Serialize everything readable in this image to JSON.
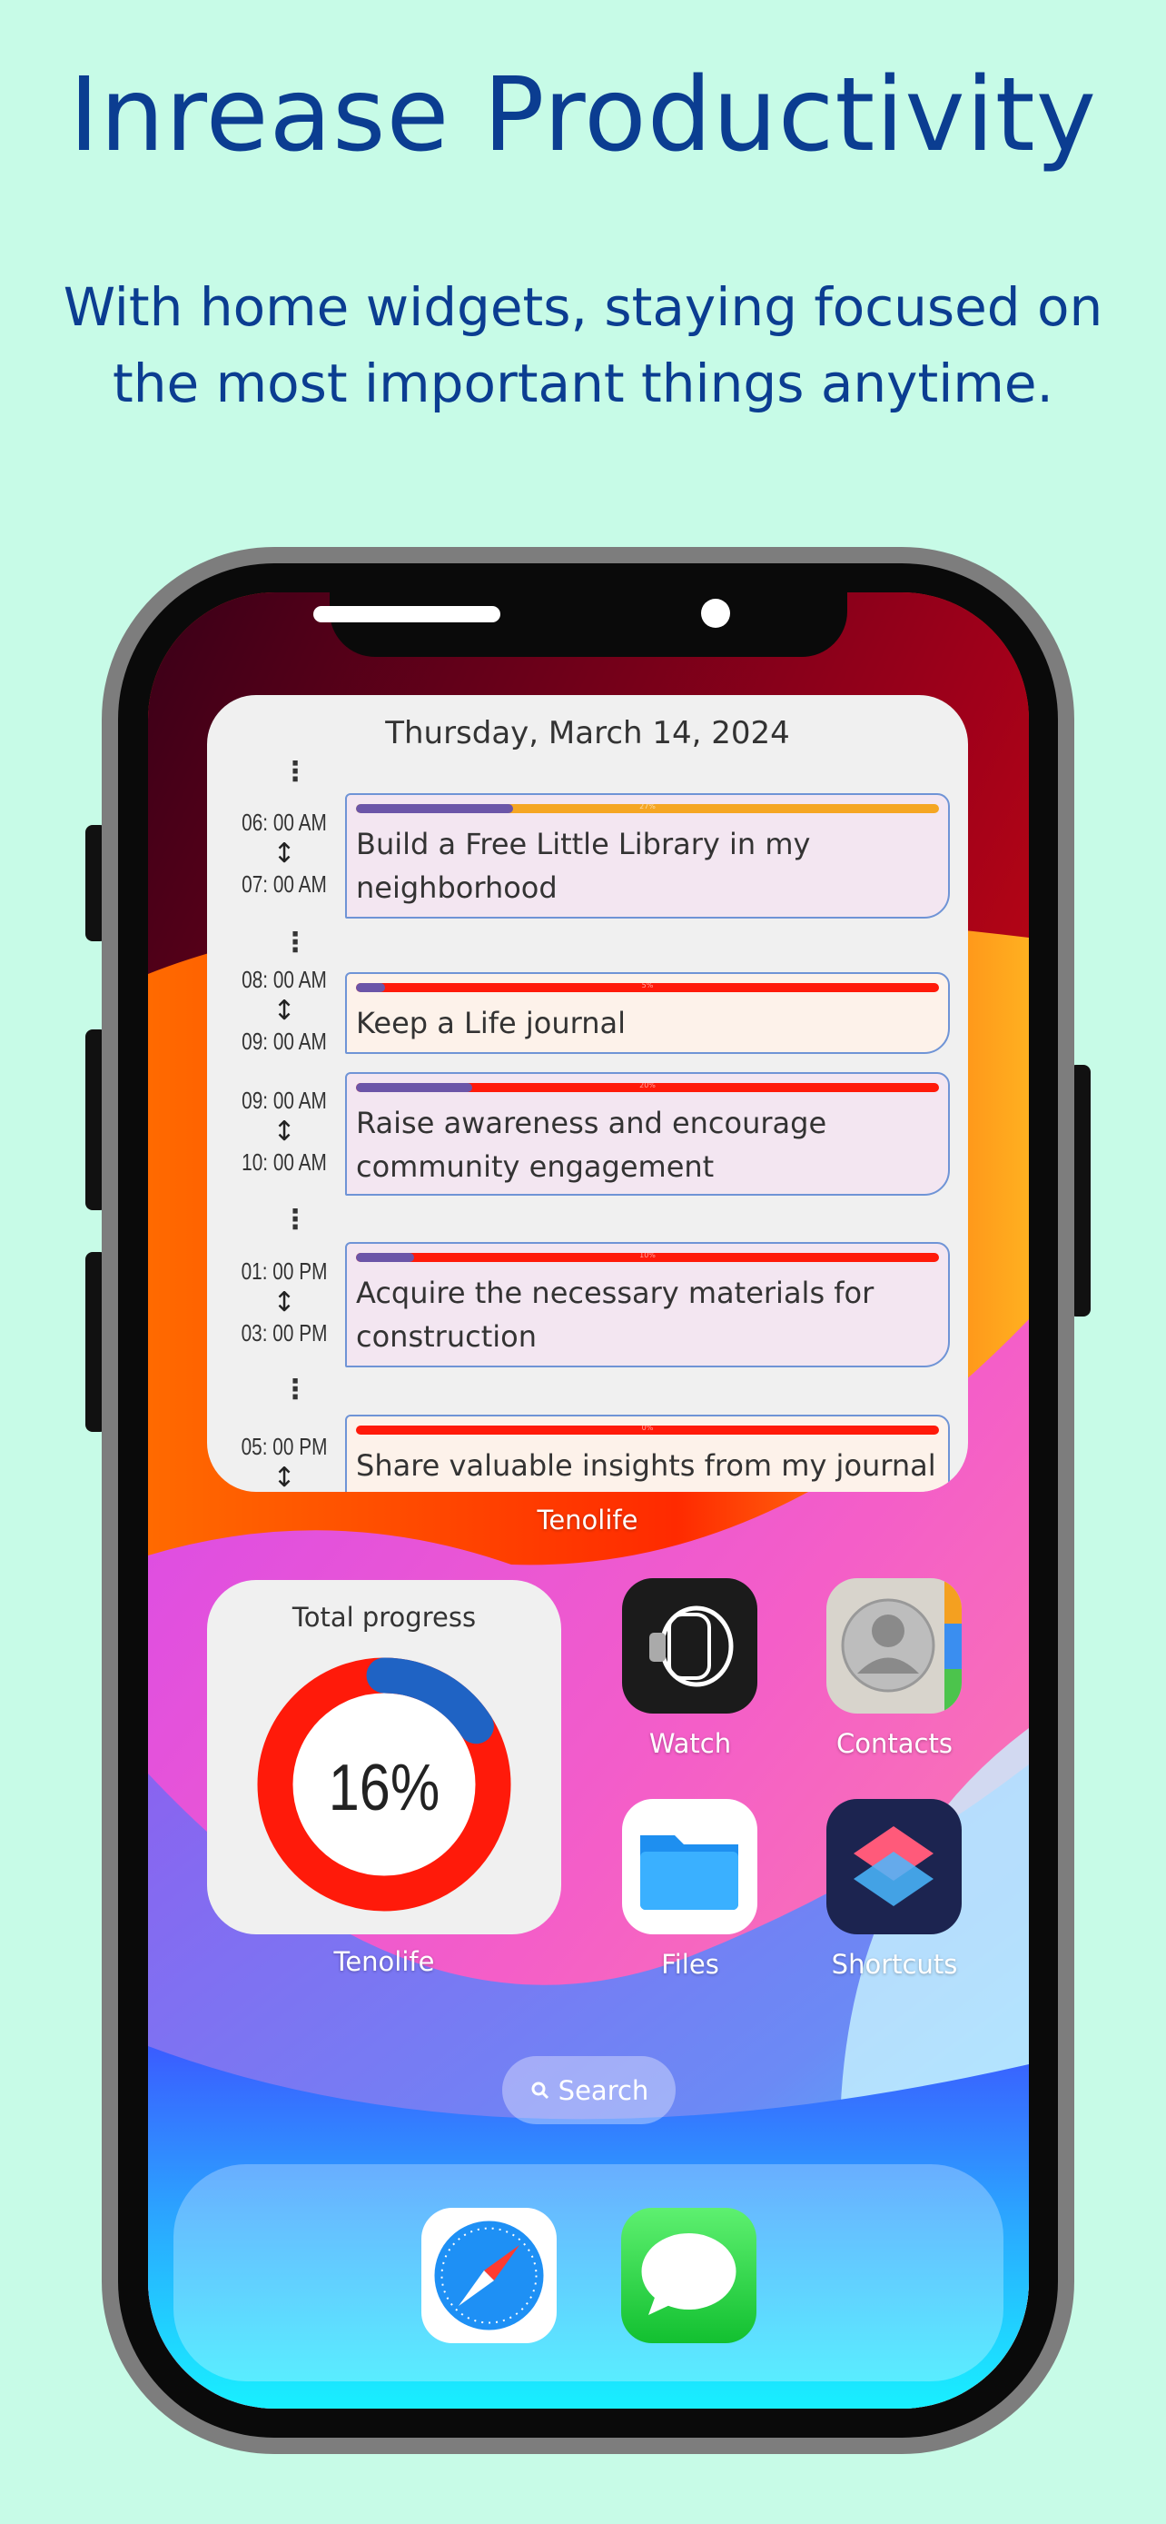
{
  "header": {
    "title": "Inrease Productivity",
    "subtitle_line1": "With home widgets, staying focused on",
    "subtitle_line2": "the most important things anytime."
  },
  "schedule_widget": {
    "date": "Thursday, March 14, 2024",
    "app_label": "Tenolife",
    "items": [
      {
        "start": "06: 00 AM",
        "end": "07: 00 AM",
        "title": "Build a Free Little Library in my neighborhood",
        "progress": 27,
        "progress_label": "27%",
        "track_color": "#f5a623",
        "card_color": "#f3e6f1"
      },
      {
        "start": "08: 00 AM",
        "end": "09: 00 AM",
        "title": "Keep a Life journal",
        "progress": 5,
        "progress_label": "5%",
        "track_color": "#ff1a0a",
        "card_color": "#fdf2ea"
      },
      {
        "start": "09: 00 AM",
        "end": "10: 00 AM",
        "title": "Raise awareness and encourage community engagement",
        "progress": 20,
        "progress_label": "20%",
        "track_color": "#ff1a0a",
        "card_color": "#f3e6f1"
      },
      {
        "start": "01: 00 PM",
        "end": "03: 00 PM",
        "title": "Acquire the necessary materials for construction",
        "progress": 10,
        "progress_label": "10%",
        "track_color": "#ff1a0a",
        "card_color": "#f3e6f1"
      },
      {
        "start": "05: 00 PM",
        "end": "",
        "title": "Share valuable insights from my journal",
        "progress": 0,
        "progress_label": "0%",
        "track_color": "#ff1a0a",
        "card_color": "#fdf2ea"
      }
    ]
  },
  "progress_widget": {
    "title": "Total progress",
    "value": 16,
    "value_label": "16%",
    "app_label": "Tenolife",
    "done_color": "#1f63c4",
    "remaining_color": "#ff1a0a"
  },
  "apps": [
    {
      "name": "Watch",
      "icon": "watch-icon"
    },
    {
      "name": "Contacts",
      "icon": "contacts-icon"
    },
    {
      "name": "Files",
      "icon": "files-icon"
    },
    {
      "name": "Shortcuts",
      "icon": "shortcuts-icon"
    }
  ],
  "search": {
    "label": "Search",
    "icon": "search-icon"
  },
  "dock": [
    {
      "name": "Safari",
      "icon": "safari-icon"
    },
    {
      "name": "Messages",
      "icon": "messages-icon"
    }
  ],
  "colors": {
    "background": "#c7fbe7",
    "title": "#0b3d91",
    "phone_frame": "#7d7d7d"
  }
}
